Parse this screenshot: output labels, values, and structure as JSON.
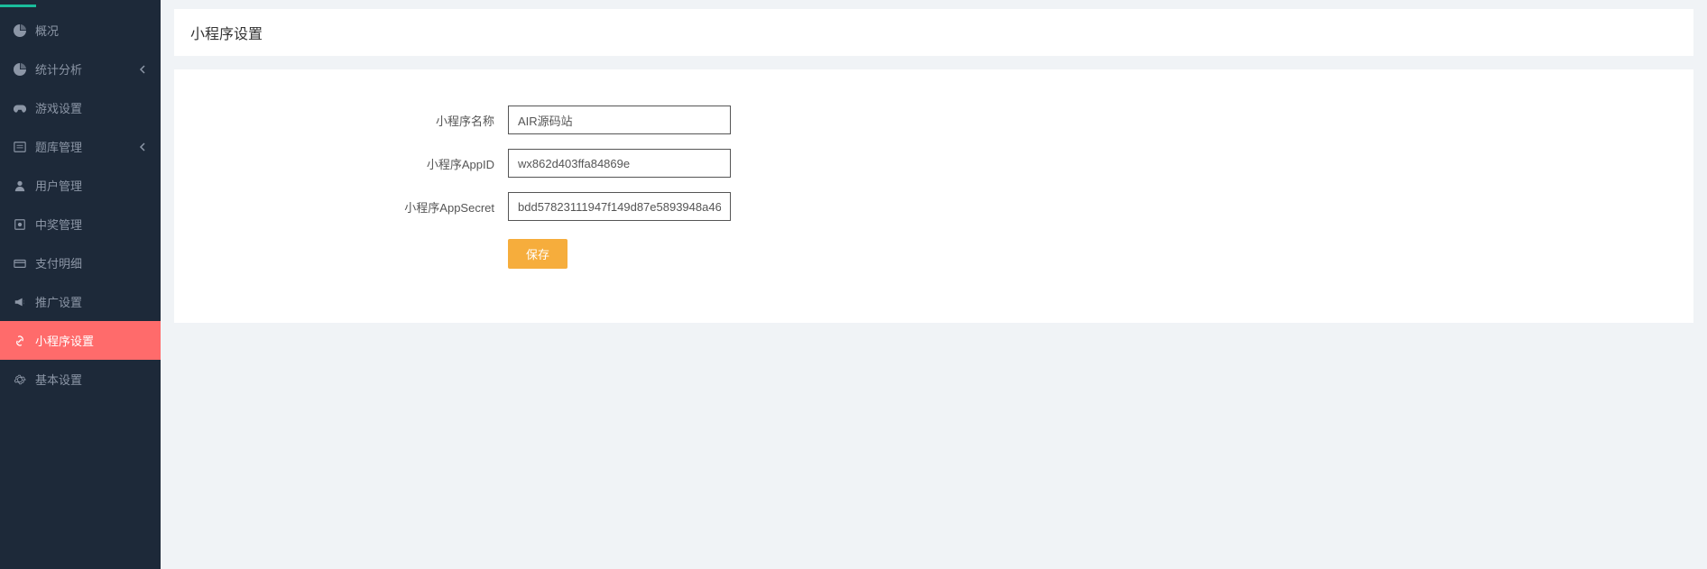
{
  "sidebar": {
    "items": [
      {
        "label": "概况",
        "icon": "pie-chart"
      },
      {
        "label": "统计分析",
        "icon": "pie-chart",
        "expandable": true
      },
      {
        "label": "游戏设置",
        "icon": "gamepad"
      },
      {
        "label": "题库管理",
        "icon": "list",
        "expandable": true
      },
      {
        "label": "用户管理",
        "icon": "user"
      },
      {
        "label": "中奖管理",
        "icon": "badge"
      },
      {
        "label": "支付明细",
        "icon": "card"
      },
      {
        "label": "推广设置",
        "icon": "megaphone"
      },
      {
        "label": "小程序设置",
        "icon": "link",
        "active": true
      },
      {
        "label": "基本设置",
        "icon": "gear"
      }
    ]
  },
  "page": {
    "title": "小程序设置"
  },
  "form": {
    "name_label": "小程序名称",
    "name_value": "AIR源码站",
    "appid_label": "小程序AppID",
    "appid_value": "wx862d403ffa84869e",
    "secret_label": "小程序AppSecret",
    "secret_value": "bdd57823111947f149d87e5893948a46",
    "save_label": "保存"
  }
}
